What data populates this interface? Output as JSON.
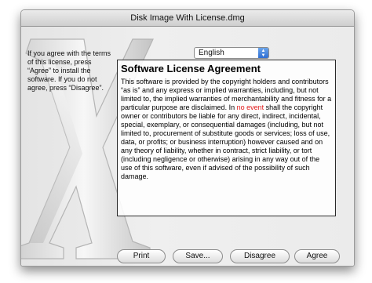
{
  "window": {
    "title": "Disk Image With License.dmg"
  },
  "instructions": {
    "text": "If you agree with the terms of this license, press “Agree” to install the software. If you do not agree, press “Disagree”."
  },
  "language_select": {
    "selected": "English"
  },
  "license": {
    "heading": "Software License Agreement",
    "body_1": "This software is provided by the copyright holders and contributors “as is” and any express or implied warranties, including, but not limited to, the implied warranties of merchantability and fitness for a particular purpose are disclaimed. In ",
    "body_highlight": "no event",
    "body_2": " shall the copyright owner or contributors be liable for any direct, indirect, incidental, special, exemplary, or consequential damages (including, but not limited to, procurement of substitute goods or services; loss of use, data, or profits; or business interruption) however caused and on any theory of liability, whether in contract, strict liability, or tort (including negligence or otherwise) arising in any way out of the use of this software, even if advised of the possibility of such damage."
  },
  "buttons": {
    "print": "Print",
    "save": "Save...",
    "disagree": "Disagree",
    "agree": "Agree"
  },
  "colors": {
    "highlight_text": "#e11a1a",
    "popup_arrows": "#2f6fd4"
  }
}
